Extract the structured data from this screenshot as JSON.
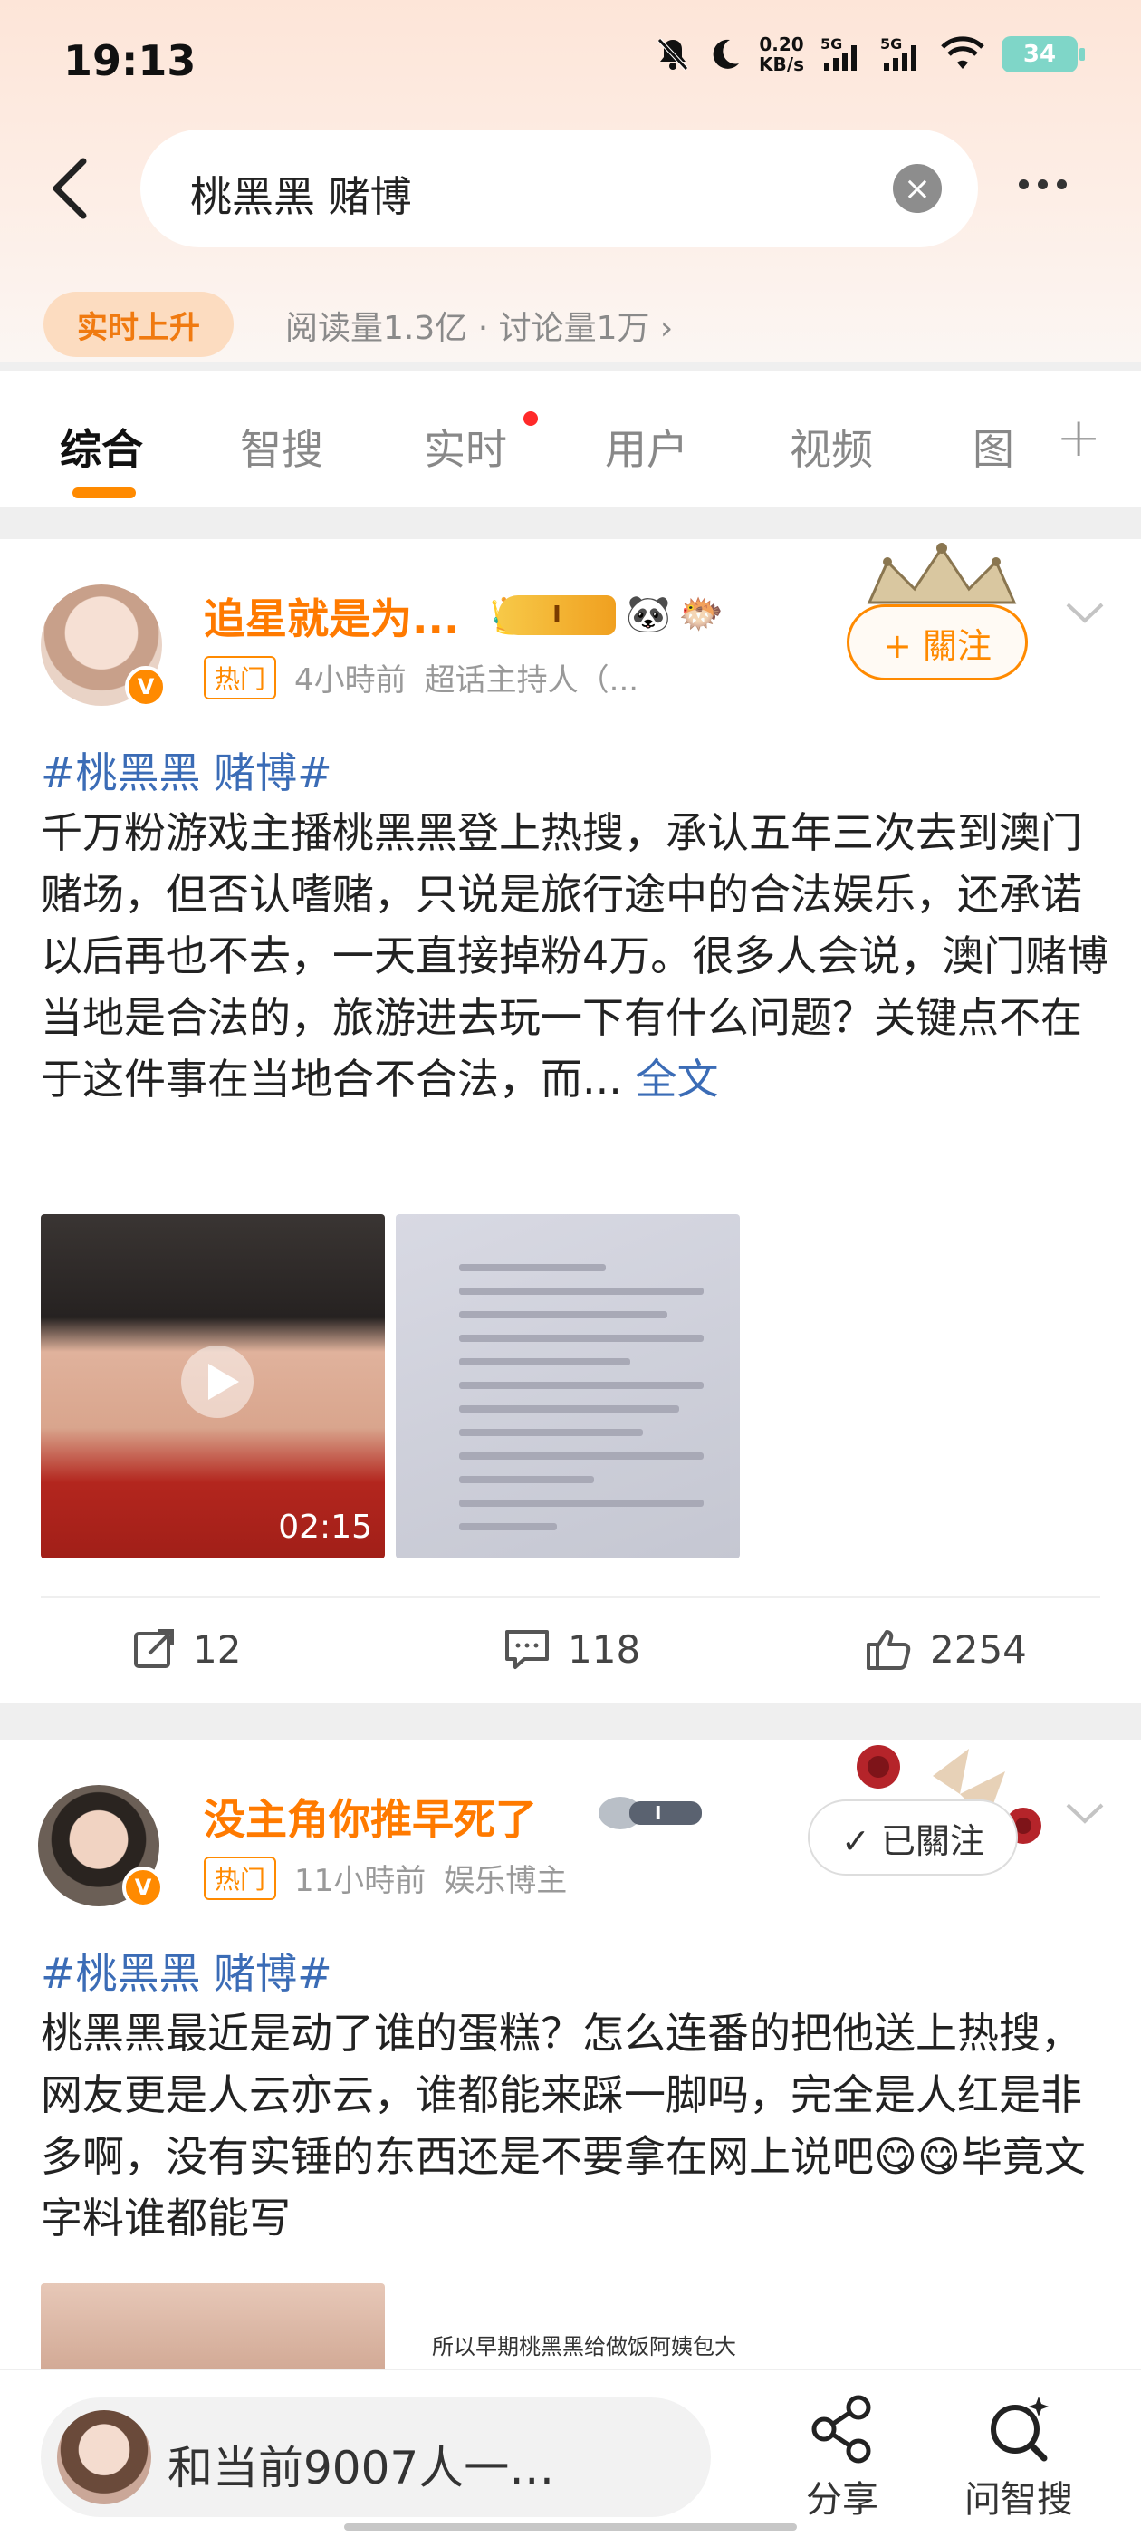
{
  "status": {
    "time": "19:13",
    "net_speed_value": "0.20",
    "net_speed_unit": "KB/s",
    "signal1": "5G",
    "signal2": "5G",
    "battery": "34"
  },
  "search": {
    "query": "桃黑黑 赌博"
  },
  "trend": {
    "badge": "实时上升",
    "stats": "阅读量1.3亿 · 讨论量1万 ›"
  },
  "tabs": [
    {
      "label": "综合"
    },
    {
      "label": "智搜"
    },
    {
      "label": "实时"
    },
    {
      "label": "用户"
    },
    {
      "label": "视频"
    },
    {
      "label": "图"
    }
  ],
  "tab_plus": "+",
  "post1": {
    "username": "追星就是为...",
    "medal": "I",
    "hot_tag": "热门",
    "time": "4小時前",
    "source": "超话主持人（...",
    "follow": "+ 關注",
    "topic": "#桃黑黑 赌博#",
    "body": "千万粉游戏主播桃黑黑登上热搜，承认五年三次去到澳门赌场，但否认嗜赌，只说是旅行途中的合法娱乐，还承诺以后再也不去，一天直接掉粉4万。很多人会说，澳门赌博当地是合法的，旅游进去玩一下有什么问题？关键点不在于这件事在当地合不合法，而...",
    "full_text": "全文",
    "video_duration": "02:15",
    "reposts": "12",
    "comments": "118",
    "likes": "2254"
  },
  "post2": {
    "username": "没主角你推早死了",
    "hot_tag": "热门",
    "time": "11小時前",
    "source": "娱乐博主",
    "follow": "✓ 已關注",
    "topic": "#桃黑黑 赌博#",
    "body": "桃黑黑最近是动了谁的蛋糕？怎么连番的把他送上热搜，网友更是人云亦云，谁都能来踩一脚吗，完全是人红是非多啊，没有实锤的东西还是不要拿在网上说吧😋😋毕竟文字料谁都能写",
    "image_caption": "所以早期桃黑黑给做饭阿姨包大"
  },
  "bottom": {
    "chat_text": "和当前9007人一…",
    "share": "分享",
    "ask": "问智搜"
  },
  "colors": {
    "accent": "#ff7a00",
    "link": "#3b6cb6"
  }
}
